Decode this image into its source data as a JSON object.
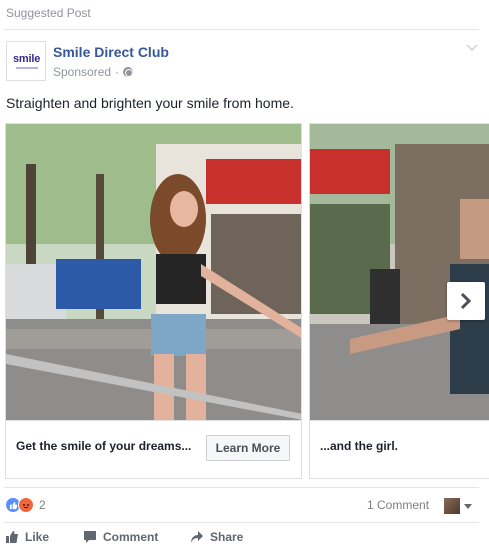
{
  "feed": {
    "suggested_label": "Suggested Post"
  },
  "post": {
    "page_name": "Smile Direct Club",
    "logo_text": "smile",
    "sponsored_label": "Sponsored",
    "separator": "·",
    "text": "Straighten and brighten your smile from home."
  },
  "carousel": {
    "cards": [
      {
        "title": "Get the smile of your dreams...",
        "cta": "Learn More"
      },
      {
        "title": "...and the girl."
      }
    ]
  },
  "engagement": {
    "reaction_count": "2",
    "comments_label": "1 Comment"
  },
  "actions": {
    "like": "Like",
    "comment": "Comment",
    "share": "Share"
  },
  "colors": {
    "link_blue": "#365899",
    "like_blue": "#5890ff",
    "angry_orange": "#f0663c",
    "muted": "#90949c"
  },
  "icons": [
    "globe-icon",
    "chevron-down-icon",
    "chevron-right-icon",
    "like-reaction-icon",
    "angry-reaction-icon",
    "like-icon",
    "comment-icon",
    "share-icon"
  ]
}
